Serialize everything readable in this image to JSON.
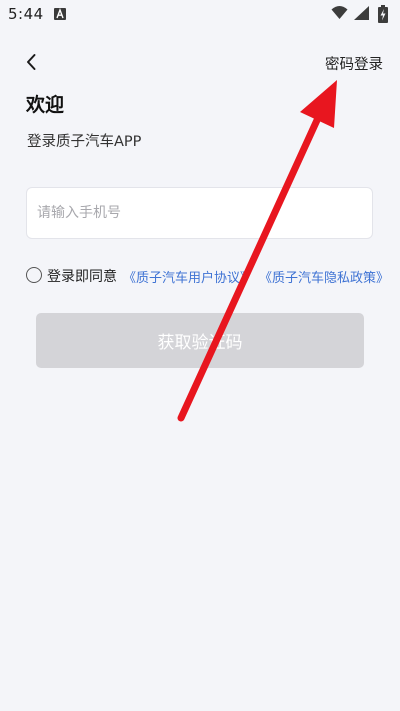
{
  "status_bar": {
    "time": "5:44",
    "icons": [
      "notification-a-icon",
      "wifi-icon",
      "signal-icon",
      "battery-charging-icon"
    ]
  },
  "header": {
    "back_icon": "chevron-left-icon",
    "password_login_label": "密码登录"
  },
  "main": {
    "title": "欢迎",
    "subtitle": "登录质子汽车APP",
    "phone_input": {
      "placeholder": "请输入手机号",
      "value": ""
    },
    "agreement": {
      "checked": false,
      "prefix": "登录即同意",
      "user_agreement_link": "《质子汽车用户协议》",
      "privacy_policy_link": "《质子汽车隐私政策》"
    },
    "get_code_button_label": "获取验证码"
  },
  "colors": {
    "background": "#f4f5f9",
    "link": "#3f73d4",
    "button_disabled": "#d4d4d8",
    "annotation_arrow": "#e8161f"
  }
}
